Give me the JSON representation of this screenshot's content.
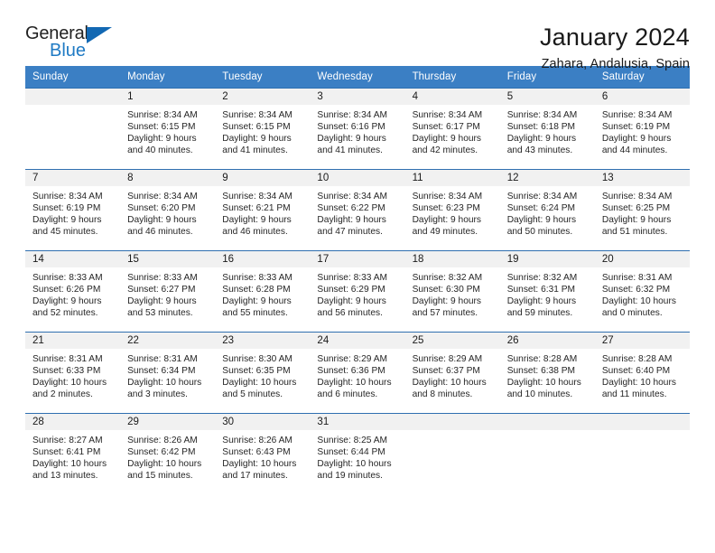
{
  "brand": {
    "name_part1": "General",
    "name_part2": "Blue"
  },
  "header": {
    "title": "January 2024",
    "subtitle": "Zahara, Andalusia, Spain"
  },
  "colors": {
    "header_blue": "#3b7fc4",
    "border_blue": "#2f6fb0",
    "daynum_bg": "#f1f1f1",
    "logo_blue": "#1f7ac4"
  },
  "weekday_headers": [
    "Sunday",
    "Monday",
    "Tuesday",
    "Wednesday",
    "Thursday",
    "Friday",
    "Saturday"
  ],
  "weeks": [
    [
      {
        "day": "",
        "sunrise": "",
        "sunset": "",
        "daylight1": "",
        "daylight2": ""
      },
      {
        "day": "1",
        "sunrise": "Sunrise: 8:34 AM",
        "sunset": "Sunset: 6:15 PM",
        "daylight1": "Daylight: 9 hours",
        "daylight2": "and 40 minutes."
      },
      {
        "day": "2",
        "sunrise": "Sunrise: 8:34 AM",
        "sunset": "Sunset: 6:15 PM",
        "daylight1": "Daylight: 9 hours",
        "daylight2": "and 41 minutes."
      },
      {
        "day": "3",
        "sunrise": "Sunrise: 8:34 AM",
        "sunset": "Sunset: 6:16 PM",
        "daylight1": "Daylight: 9 hours",
        "daylight2": "and 41 minutes."
      },
      {
        "day": "4",
        "sunrise": "Sunrise: 8:34 AM",
        "sunset": "Sunset: 6:17 PM",
        "daylight1": "Daylight: 9 hours",
        "daylight2": "and 42 minutes."
      },
      {
        "day": "5",
        "sunrise": "Sunrise: 8:34 AM",
        "sunset": "Sunset: 6:18 PM",
        "daylight1": "Daylight: 9 hours",
        "daylight2": "and 43 minutes."
      },
      {
        "day": "6",
        "sunrise": "Sunrise: 8:34 AM",
        "sunset": "Sunset: 6:19 PM",
        "daylight1": "Daylight: 9 hours",
        "daylight2": "and 44 minutes."
      }
    ],
    [
      {
        "day": "7",
        "sunrise": "Sunrise: 8:34 AM",
        "sunset": "Sunset: 6:19 PM",
        "daylight1": "Daylight: 9 hours",
        "daylight2": "and 45 minutes."
      },
      {
        "day": "8",
        "sunrise": "Sunrise: 8:34 AM",
        "sunset": "Sunset: 6:20 PM",
        "daylight1": "Daylight: 9 hours",
        "daylight2": "and 46 minutes."
      },
      {
        "day": "9",
        "sunrise": "Sunrise: 8:34 AM",
        "sunset": "Sunset: 6:21 PM",
        "daylight1": "Daylight: 9 hours",
        "daylight2": "and 46 minutes."
      },
      {
        "day": "10",
        "sunrise": "Sunrise: 8:34 AM",
        "sunset": "Sunset: 6:22 PM",
        "daylight1": "Daylight: 9 hours",
        "daylight2": "and 47 minutes."
      },
      {
        "day": "11",
        "sunrise": "Sunrise: 8:34 AM",
        "sunset": "Sunset: 6:23 PM",
        "daylight1": "Daylight: 9 hours",
        "daylight2": "and 49 minutes."
      },
      {
        "day": "12",
        "sunrise": "Sunrise: 8:34 AM",
        "sunset": "Sunset: 6:24 PM",
        "daylight1": "Daylight: 9 hours",
        "daylight2": "and 50 minutes."
      },
      {
        "day": "13",
        "sunrise": "Sunrise: 8:34 AM",
        "sunset": "Sunset: 6:25 PM",
        "daylight1": "Daylight: 9 hours",
        "daylight2": "and 51 minutes."
      }
    ],
    [
      {
        "day": "14",
        "sunrise": "Sunrise: 8:33 AM",
        "sunset": "Sunset: 6:26 PM",
        "daylight1": "Daylight: 9 hours",
        "daylight2": "and 52 minutes."
      },
      {
        "day": "15",
        "sunrise": "Sunrise: 8:33 AM",
        "sunset": "Sunset: 6:27 PM",
        "daylight1": "Daylight: 9 hours",
        "daylight2": "and 53 minutes."
      },
      {
        "day": "16",
        "sunrise": "Sunrise: 8:33 AM",
        "sunset": "Sunset: 6:28 PM",
        "daylight1": "Daylight: 9 hours",
        "daylight2": "and 55 minutes."
      },
      {
        "day": "17",
        "sunrise": "Sunrise: 8:33 AM",
        "sunset": "Sunset: 6:29 PM",
        "daylight1": "Daylight: 9 hours",
        "daylight2": "and 56 minutes."
      },
      {
        "day": "18",
        "sunrise": "Sunrise: 8:32 AM",
        "sunset": "Sunset: 6:30 PM",
        "daylight1": "Daylight: 9 hours",
        "daylight2": "and 57 minutes."
      },
      {
        "day": "19",
        "sunrise": "Sunrise: 8:32 AM",
        "sunset": "Sunset: 6:31 PM",
        "daylight1": "Daylight: 9 hours",
        "daylight2": "and 59 minutes."
      },
      {
        "day": "20",
        "sunrise": "Sunrise: 8:31 AM",
        "sunset": "Sunset: 6:32 PM",
        "daylight1": "Daylight: 10 hours",
        "daylight2": "and 0 minutes."
      }
    ],
    [
      {
        "day": "21",
        "sunrise": "Sunrise: 8:31 AM",
        "sunset": "Sunset: 6:33 PM",
        "daylight1": "Daylight: 10 hours",
        "daylight2": "and 2 minutes."
      },
      {
        "day": "22",
        "sunrise": "Sunrise: 8:31 AM",
        "sunset": "Sunset: 6:34 PM",
        "daylight1": "Daylight: 10 hours",
        "daylight2": "and 3 minutes."
      },
      {
        "day": "23",
        "sunrise": "Sunrise: 8:30 AM",
        "sunset": "Sunset: 6:35 PM",
        "daylight1": "Daylight: 10 hours",
        "daylight2": "and 5 minutes."
      },
      {
        "day": "24",
        "sunrise": "Sunrise: 8:29 AM",
        "sunset": "Sunset: 6:36 PM",
        "daylight1": "Daylight: 10 hours",
        "daylight2": "and 6 minutes."
      },
      {
        "day": "25",
        "sunrise": "Sunrise: 8:29 AM",
        "sunset": "Sunset: 6:37 PM",
        "daylight1": "Daylight: 10 hours",
        "daylight2": "and 8 minutes."
      },
      {
        "day": "26",
        "sunrise": "Sunrise: 8:28 AM",
        "sunset": "Sunset: 6:38 PM",
        "daylight1": "Daylight: 10 hours",
        "daylight2": "and 10 minutes."
      },
      {
        "day": "27",
        "sunrise": "Sunrise: 8:28 AM",
        "sunset": "Sunset: 6:40 PM",
        "daylight1": "Daylight: 10 hours",
        "daylight2": "and 11 minutes."
      }
    ],
    [
      {
        "day": "28",
        "sunrise": "Sunrise: 8:27 AM",
        "sunset": "Sunset: 6:41 PM",
        "daylight1": "Daylight: 10 hours",
        "daylight2": "and 13 minutes."
      },
      {
        "day": "29",
        "sunrise": "Sunrise: 8:26 AM",
        "sunset": "Sunset: 6:42 PM",
        "daylight1": "Daylight: 10 hours",
        "daylight2": "and 15 minutes."
      },
      {
        "day": "30",
        "sunrise": "Sunrise: 8:26 AM",
        "sunset": "Sunset: 6:43 PM",
        "daylight1": "Daylight: 10 hours",
        "daylight2": "and 17 minutes."
      },
      {
        "day": "31",
        "sunrise": "Sunrise: 8:25 AM",
        "sunset": "Sunset: 6:44 PM",
        "daylight1": "Daylight: 10 hours",
        "daylight2": "and 19 minutes."
      },
      {
        "day": "",
        "sunrise": "",
        "sunset": "",
        "daylight1": "",
        "daylight2": ""
      },
      {
        "day": "",
        "sunrise": "",
        "sunset": "",
        "daylight1": "",
        "daylight2": ""
      },
      {
        "day": "",
        "sunrise": "",
        "sunset": "",
        "daylight1": "",
        "daylight2": ""
      }
    ]
  ]
}
